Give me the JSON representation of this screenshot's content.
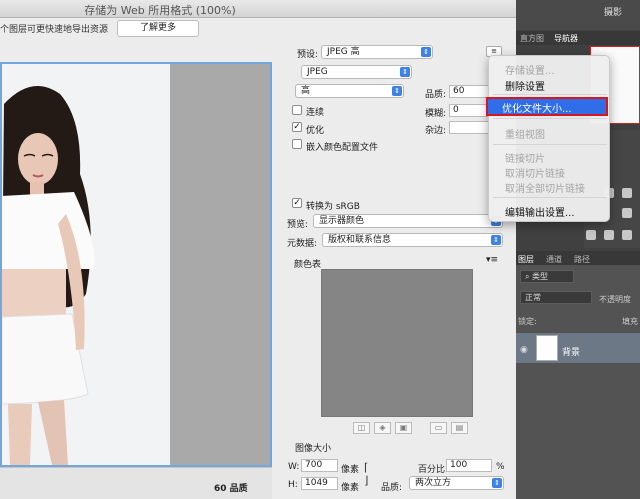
{
  "dialog": {
    "title": "存储为 Web 所用格式 (100%)",
    "notice": "个图层可更快速地导出资源",
    "learn_more": "了解更多",
    "status_quality": "60 品质"
  },
  "settings": {
    "preset_label": "预设:",
    "preset_value": "JPEG 高",
    "format_value": "JPEG",
    "quality_level_value": "高",
    "quality_label": "品质:",
    "quality_value": "60",
    "blur_label": "模糊:",
    "blur_value": "0",
    "matte_label": "杂边:",
    "progressive_label": "连续",
    "progressive_checked": false,
    "optimized_label": "优化",
    "optimized_checked": true,
    "embed_profile_label": "嵌入颜色配置文件",
    "embed_profile_checked": false,
    "convert_srgb_label": "转换为 sRGB",
    "convert_srgb_checked": true,
    "preview_label": "预览:",
    "preview_value": "显示器颜色",
    "metadata_label": "元数据:",
    "metadata_value": "版权和联系信息",
    "color_table_label": "颜色表",
    "image_size_label": "图像大小",
    "width_label": "W:",
    "width_value": "700",
    "height_label": "H:",
    "height_value": "1049",
    "unit_pixels": "像素",
    "percent_label": "百分比:",
    "percent_value": "100",
    "percent_unit": "%",
    "resample_label": "品质:",
    "resample_value": "两次立方"
  },
  "context_menu": {
    "items": [
      {
        "label": "存储设置...",
        "disabled": true
      },
      {
        "label": "删除设置",
        "disabled": false
      },
      {
        "label": "优化文件大小...",
        "disabled": false,
        "highlighted": true
      },
      {
        "label": "重组视图",
        "disabled": true
      },
      {
        "label": "链接切片",
        "disabled": true
      },
      {
        "label": "取消切片链接",
        "disabled": true
      },
      {
        "label": "取消全部切片链接",
        "disabled": true
      },
      {
        "label": "编辑输出设置...",
        "disabled": false
      }
    ]
  },
  "ps_panel": {
    "top_right": "摄影",
    "nav_tabs": [
      "直方图",
      "导航器"
    ],
    "layers_tabs": [
      "图层",
      "通道",
      "路径"
    ],
    "filter_value": "类型",
    "blend_mode": "正常",
    "opacity_label": "不透明度",
    "lock_label": "锁定:",
    "fill_label": "填充",
    "layer_name": "背景"
  },
  "colors": {
    "accent": "#3d82e4",
    "highlight": "#2f6ee8",
    "highlight_border": "#d9161e",
    "preview_border": "#72a7dc"
  }
}
